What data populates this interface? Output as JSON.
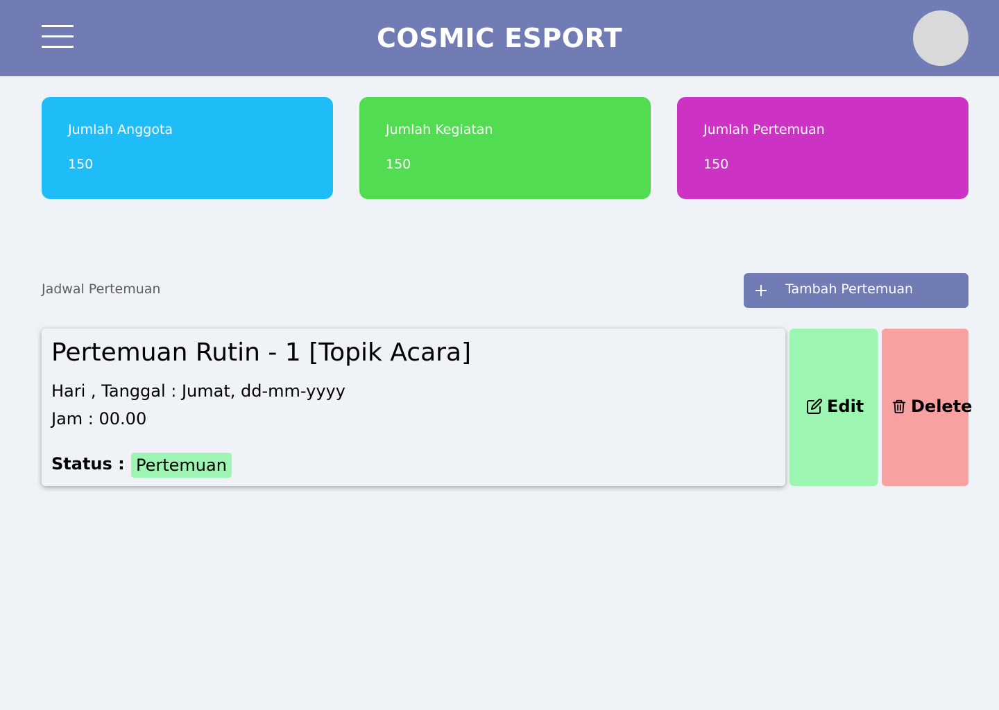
{
  "header": {
    "title": "COSMIC ESPORT",
    "menu_icon": "hamburger-menu-icon",
    "avatar_icon": "user-avatar",
    "background": "#717cb4"
  },
  "stats": [
    {
      "label": "Jumlah Anggota",
      "value": "150",
      "color": "#1fbdf8"
    },
    {
      "label": "Jumlah Kegiatan",
      "value": "150",
      "color": "#52dc51"
    },
    {
      "label": "Jumlah Pertemuan",
      "value": "150",
      "color": "#cc33c4"
    }
  ],
  "schedule": {
    "section_title": "Jadwal Pertemuan",
    "add_button": {
      "label": "Tambah Pertemuan",
      "icon": "plus-icon"
    }
  },
  "meeting": {
    "title": "Pertemuan Rutin - 1 [Topik Acara]",
    "date_line": "Hari , Tanggal : Jumat, dd-mm-yyyy",
    "time_line": "Jam : 00.00",
    "status_label": "Status :",
    "status_value": "Pertemuan",
    "status_color": "#9cf6b2"
  },
  "actions": {
    "edit_label": "Edit",
    "edit_icon": "edit-icon",
    "edit_color": "#9cf6b2",
    "delete_label": "Delete",
    "delete_icon": "trash-icon",
    "delete_color": "#f7a1a1"
  }
}
